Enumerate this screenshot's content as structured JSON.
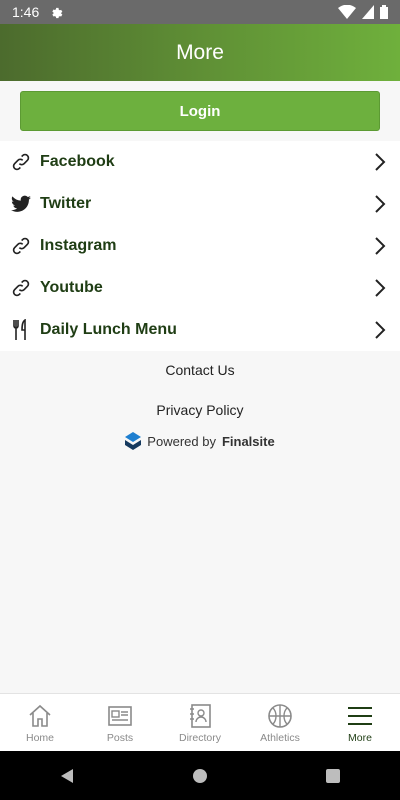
{
  "status_bar": {
    "time": "1:46"
  },
  "header": {
    "title": "More"
  },
  "login": {
    "label": "Login"
  },
  "menu_items": [
    {
      "label": "Facebook",
      "icon": "link-icon"
    },
    {
      "label": "Twitter",
      "icon": "twitter-icon"
    },
    {
      "label": "Instagram",
      "icon": "link-icon"
    },
    {
      "label": "Youtube",
      "icon": "link-icon"
    },
    {
      "label": "Daily Lunch Menu",
      "icon": "fork-knife-icon"
    }
  ],
  "links": {
    "contact": "Contact Us",
    "privacy": "Privacy Policy"
  },
  "powered": {
    "prefix": "Powered by",
    "brand": "Finalsite"
  },
  "bottom_nav": [
    {
      "label": "Home",
      "icon": "home-icon"
    },
    {
      "label": "Posts",
      "icon": "posts-icon"
    },
    {
      "label": "Directory",
      "icon": "directory-icon"
    },
    {
      "label": "Athletics",
      "icon": "basketball-icon"
    },
    {
      "label": "More",
      "icon": "menu-icon",
      "active": true
    }
  ],
  "colors": {
    "header_start": "#4c6b2d",
    "header_end": "#6fb03c",
    "accent": "#6db03e",
    "label": "#1f3d14"
  }
}
